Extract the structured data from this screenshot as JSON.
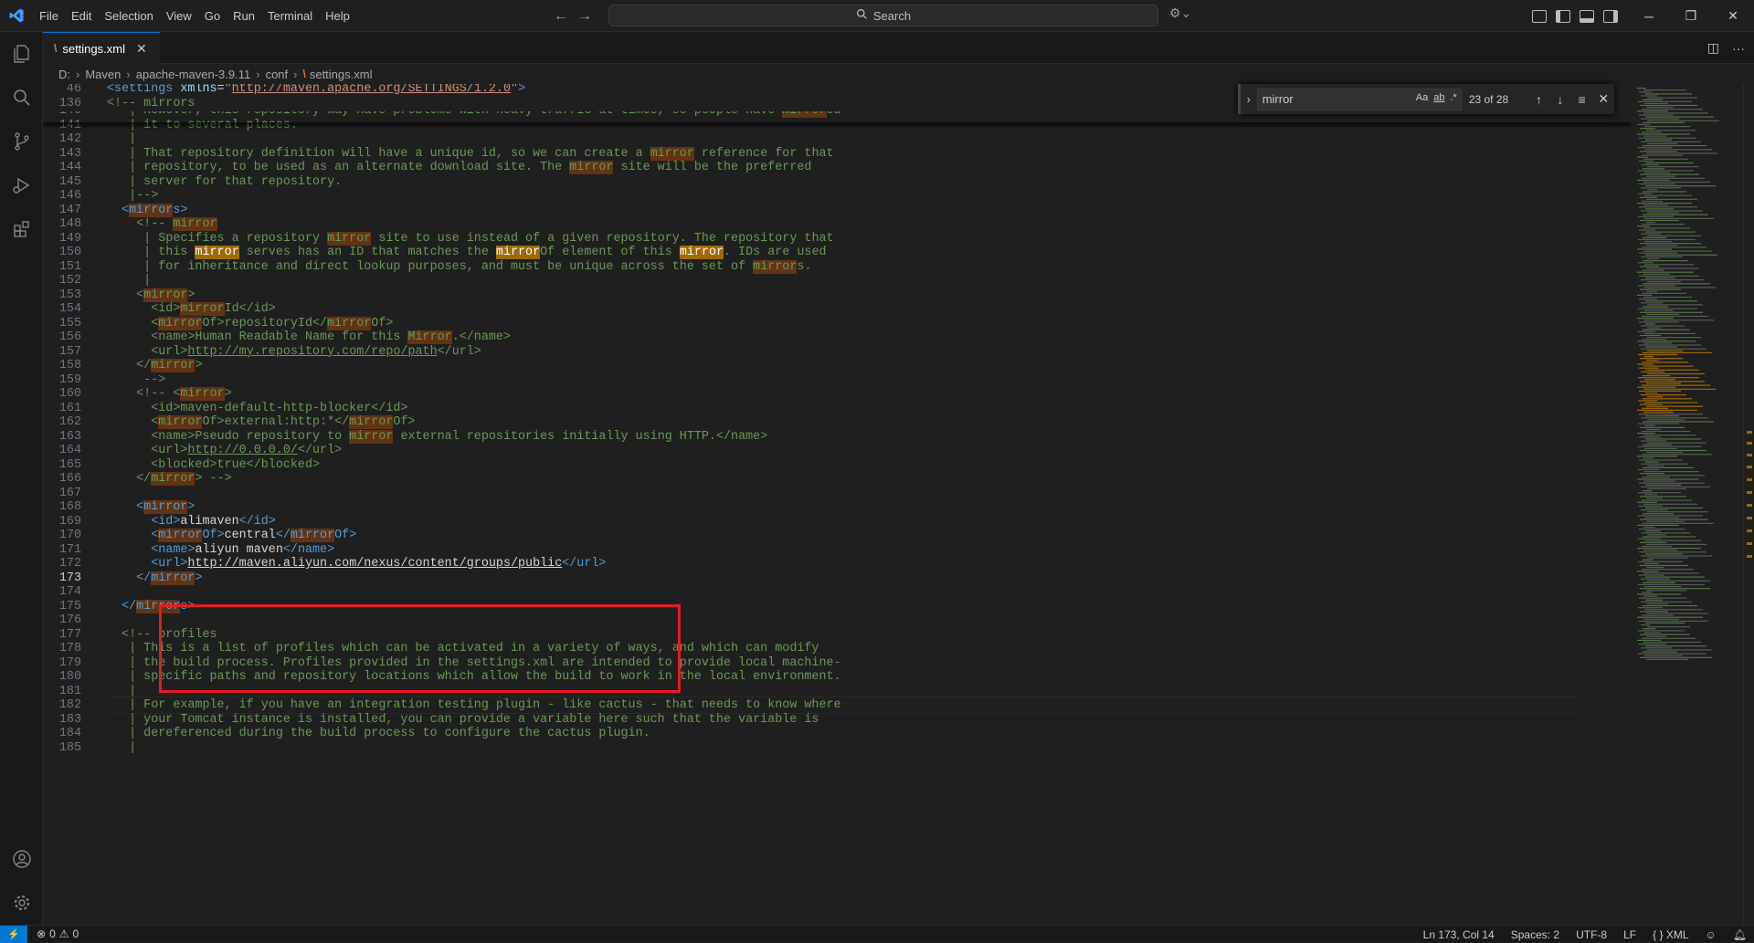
{
  "menu": [
    "File",
    "Edit",
    "Selection",
    "View",
    "Go",
    "Run",
    "Terminal",
    "Help"
  ],
  "search_placeholder": "Search",
  "tab": {
    "label": "settings.xml"
  },
  "breadcrumb": [
    "D:",
    "Maven",
    "apache-maven-3.9.11",
    "conf",
    "settings.xml"
  ],
  "find": {
    "query": "mirror",
    "count": "23 of 28",
    "opt_case": "Aa",
    "opt_word": "ab",
    "opt_regex": ".*"
  },
  "sticky_lines": [
    {
      "n": "46",
      "segs": [
        [
          "t",
          "<settings "
        ],
        [
          "a",
          "xmlns"
        ],
        [
          "tx",
          "="
        ],
        [
          "s",
          "\""
        ],
        [
          "su",
          "http://maven.apache.org/SETTINGS/1.2.0"
        ],
        [
          "s",
          "\""
        ],
        [
          "t",
          ">"
        ]
      ]
    },
    {
      "n": "136",
      "segs": [
        [
          "c",
          "<!-- mirrors"
        ]
      ]
    }
  ],
  "lines": [
    {
      "n": "140",
      "segs": [
        [
          "c",
          "   | However, this repository may have problems with heavy traffic at times, so people have "
        ],
        [
          "ch",
          "mirror"
        ],
        [
          "c",
          "ed"
        ]
      ]
    },
    {
      "n": "141",
      "segs": [
        [
          "c",
          "   | it to several places."
        ]
      ]
    },
    {
      "n": "142",
      "segs": [
        [
          "c",
          "   |"
        ]
      ]
    },
    {
      "n": "143",
      "segs": [
        [
          "c",
          "   | That repository definition will have a unique id, so we can create a "
        ],
        [
          "ch",
          "mirror"
        ],
        [
          "c",
          " reference for that"
        ]
      ]
    },
    {
      "n": "144",
      "segs": [
        [
          "c",
          "   | repository, to be used as an alternate download site. The "
        ],
        [
          "ch",
          "mirror"
        ],
        [
          "c",
          " site will be the preferred"
        ]
      ]
    },
    {
      "n": "145",
      "segs": [
        [
          "c",
          "   | server for that repository."
        ]
      ]
    },
    {
      "n": "146",
      "segs": [
        [
          "c",
          "   |-->"
        ]
      ]
    },
    {
      "n": "147",
      "segs": [
        [
          "t",
          "  <"
        ],
        [
          "th",
          "mirror"
        ],
        [
          "t",
          "s>"
        ]
      ]
    },
    {
      "n": "148",
      "segs": [
        [
          "c",
          "    <!-- "
        ],
        [
          "ch",
          "mirror"
        ]
      ]
    },
    {
      "n": "149",
      "segs": [
        [
          "c",
          "     | Specifies a repository "
        ],
        [
          "ch",
          "mirror"
        ],
        [
          "c",
          " site to use instead of a given repository. The repository that"
        ]
      ]
    },
    {
      "n": "150",
      "segs": [
        [
          "c",
          "     | this "
        ],
        [
          "ch",
          "mirror"
        ],
        [
          "c",
          " serves has an ID that matches the "
        ],
        [
          "ch",
          "mirror"
        ],
        [
          "c",
          "Of element of this "
        ],
        [
          "ch",
          "mirror"
        ],
        [
          "c",
          ". IDs are used"
        ]
      ]
    },
    {
      "n": "151",
      "segs": [
        [
          "c",
          "     | for inheritance and direct lookup purposes, and must be unique across the set of "
        ],
        [
          "ch",
          "mirror"
        ],
        [
          "c",
          "s."
        ]
      ]
    },
    {
      "n": "152",
      "segs": [
        [
          "c",
          "     |"
        ]
      ]
    },
    {
      "n": "153",
      "segs": [
        [
          "c",
          "    <"
        ],
        [
          "ch",
          "mirror"
        ],
        [
          "c",
          ">"
        ]
      ]
    },
    {
      "n": "154",
      "segs": [
        [
          "c",
          "      <id>"
        ],
        [
          "ch",
          "mirror"
        ],
        [
          "c",
          "Id</id>"
        ]
      ]
    },
    {
      "n": "155",
      "segs": [
        [
          "c",
          "      <"
        ],
        [
          "ch",
          "mirror"
        ],
        [
          "c",
          "Of>repositoryId</"
        ],
        [
          "ch",
          "mirror"
        ],
        [
          "c",
          "Of>"
        ]
      ]
    },
    {
      "n": "156",
      "segs": [
        [
          "c",
          "      <name>Human Readable Name for this "
        ],
        [
          "ch",
          "Mirror"
        ],
        [
          "c",
          ".</name>"
        ]
      ]
    },
    {
      "n": "157",
      "segs": [
        [
          "c",
          "      <url>"
        ],
        [
          "cu",
          "http://my.repository.com/repo/path"
        ],
        [
          "c",
          "</url>"
        ]
      ]
    },
    {
      "n": "158",
      "segs": [
        [
          "c",
          "    </"
        ],
        [
          "ch",
          "mirror"
        ],
        [
          "c",
          ">"
        ]
      ]
    },
    {
      "n": "159",
      "segs": [
        [
          "c",
          "     -->"
        ]
      ]
    },
    {
      "n": "160",
      "segs": [
        [
          "c",
          "    <!-- <"
        ],
        [
          "ch",
          "mirror"
        ],
        [
          "c",
          ">"
        ]
      ]
    },
    {
      "n": "161",
      "segs": [
        [
          "c",
          "      <id>maven-default-http-blocker</id>"
        ]
      ]
    },
    {
      "n": "162",
      "segs": [
        [
          "c",
          "      <"
        ],
        [
          "ch",
          "mirror"
        ],
        [
          "c",
          "Of>external:http:*</"
        ],
        [
          "ch",
          "mirror"
        ],
        [
          "c",
          "Of>"
        ]
      ]
    },
    {
      "n": "163",
      "segs": [
        [
          "c",
          "      <name>Pseudo repository to "
        ],
        [
          "ch",
          "mirror"
        ],
        [
          "c",
          " external repositories initially using HTTP.</name>"
        ]
      ]
    },
    {
      "n": "164",
      "segs": [
        [
          "c",
          "      <url>"
        ],
        [
          "cu",
          "http://0.0.0.0/"
        ],
        [
          "c",
          "</url>"
        ]
      ]
    },
    {
      "n": "165",
      "segs": [
        [
          "c",
          "      <blocked>true</blocked>"
        ]
      ]
    },
    {
      "n": "166",
      "segs": [
        [
          "c",
          "    </"
        ],
        [
          "ch",
          "mirror"
        ],
        [
          "c",
          "> -->"
        ]
      ]
    },
    {
      "n": "167",
      "segs": []
    },
    {
      "n": "168",
      "segs": [
        [
          "t",
          "    <"
        ],
        [
          "th",
          "mirror"
        ],
        [
          "t",
          ">"
        ]
      ]
    },
    {
      "n": "169",
      "segs": [
        [
          "t",
          "      <id>"
        ],
        [
          "tx",
          "alimaven"
        ],
        [
          "t",
          "</id>"
        ]
      ]
    },
    {
      "n": "170",
      "segs": [
        [
          "t",
          "      <"
        ],
        [
          "th",
          "mirror"
        ],
        [
          "t",
          "Of>"
        ],
        [
          "tx",
          "central"
        ],
        [
          "t",
          "</"
        ],
        [
          "th",
          "mirror"
        ],
        [
          "t",
          "Of>"
        ]
      ]
    },
    {
      "n": "171",
      "segs": [
        [
          "t",
          "      <name>"
        ],
        [
          "tx",
          "aliyun maven"
        ],
        [
          "t",
          "</name>"
        ]
      ]
    },
    {
      "n": "172",
      "segs": [
        [
          "t",
          "      <url>"
        ],
        [
          "tu",
          "http://maven.aliyun.com/nexus/content/groups/public"
        ],
        [
          "t",
          "</url>"
        ]
      ]
    },
    {
      "n": "173",
      "segs": [
        [
          "t",
          "    </"
        ],
        [
          "th",
          "mirror"
        ],
        [
          "t",
          ">"
        ]
      ]
    },
    {
      "n": "174",
      "segs": []
    },
    {
      "n": "175",
      "segs": [
        [
          "t",
          "  </"
        ],
        [
          "th",
          "mirror"
        ],
        [
          "t",
          "s>"
        ]
      ]
    },
    {
      "n": "176",
      "segs": []
    },
    {
      "n": "177",
      "segs": [
        [
          "c",
          "  <!-- profiles"
        ]
      ]
    },
    {
      "n": "178",
      "segs": [
        [
          "c",
          "   | This is a list of profiles which can be activated in a variety of ways, and which can modify"
        ]
      ]
    },
    {
      "n": "179",
      "segs": [
        [
          "c",
          "   | the build process. Profiles provided in the settings.xml are intended to provide local machine-"
        ]
      ]
    },
    {
      "n": "180",
      "segs": [
        [
          "c",
          "   | specific paths and repository locations which allow the build to work in the local environment."
        ]
      ]
    },
    {
      "n": "181",
      "segs": [
        [
          "c",
          "   |"
        ]
      ]
    },
    {
      "n": "182",
      "segs": [
        [
          "c",
          "   | For example, if you have an integration testing plugin - like cactus - that needs to know where"
        ]
      ]
    },
    {
      "n": "183",
      "segs": [
        [
          "c",
          "   | your Tomcat instance is installed, you can provide a variable here such that the variable is"
        ]
      ]
    },
    {
      "n": "184",
      "segs": [
        [
          "c",
          "   | dereferenced during the build process to configure the cactus plugin."
        ]
      ]
    },
    {
      "n": "185",
      "segs": [
        [
          "c",
          "   |"
        ]
      ]
    }
  ],
  "current_line": "173",
  "status": {
    "errors": "0",
    "warnings": "0",
    "position": "Ln 173, Col 14",
    "spaces": "Spaces: 2",
    "encoding": "UTF-8",
    "eol": "LF",
    "language": "XML"
  },
  "colors": {
    "accent": "#0078d4",
    "find_match": "#623315",
    "annotation": "#e51b24"
  }
}
